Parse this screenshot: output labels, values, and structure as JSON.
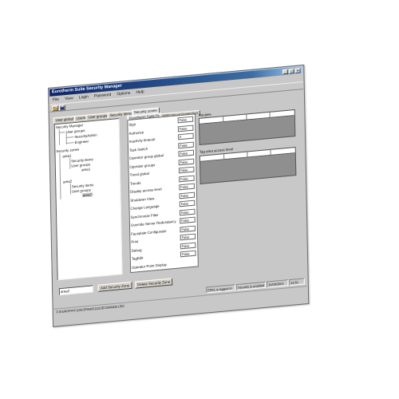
{
  "window": {
    "title": "Eurotherm Suite Security Manager"
  },
  "menu": [
    "File",
    "View",
    "Login",
    "Password",
    "Options",
    "Help"
  ],
  "toolbar": {
    "icons": [
      "open-folder-icon",
      "save-disk-icon"
    ]
  },
  "main_tabs": [
    "User global",
    "Users",
    "User groups",
    "Security items",
    "Security zones"
  ],
  "prop_tabs": [
    "Eurotherm Suite Pc",
    "1800 Visual Supervisor"
  ],
  "tree": {
    "root": "Security Manager",
    "user_groups": "User groups",
    "security_admin": "SecurityAdmin",
    "engineer": "Engineer",
    "zones": "Security zones",
    "area1": "area1",
    "security_items": "Security items",
    "user_groups_2": "User groups",
    "area1_item": "area1",
    "area2": "area2",
    "security_items_2": "Security items",
    "user_groups_3": "User groups",
    "area2_item": "area2"
  },
  "properties": [
    {
      "name": "Sign",
      "value": "False"
    },
    {
      "name": "Authorize",
      "value": "False"
    },
    {
      "name": "Inactivity timeout",
      "value": "0"
    },
    {
      "name": "Task Switch",
      "value": "False"
    },
    {
      "name": "Operator group global",
      "value": "False"
    },
    {
      "name": "Operator groups",
      "value": "False"
    },
    {
      "name": "Trend global",
      "value": "False"
    },
    {
      "name": "Trends",
      "value": "False"
    },
    {
      "name": "Display access level",
      "value": "False"
    },
    {
      "name": "Shutdown View",
      "value": "False"
    },
    {
      "name": "Change Language",
      "value": "False"
    },
    {
      "name": "Synchronize Files",
      "value": "False"
    },
    {
      "name": "Override Server Redundancy",
      "value": "False"
    },
    {
      "name": "Faceplate Configurator",
      "value": "False"
    },
    {
      "name": "Print",
      "value": "False"
    },
    {
      "name": "Debug",
      "value": "False"
    },
    {
      "name": "TagEdit",
      "value": "False"
    },
    {
      "name": "Operator Point Display",
      "value": ""
    }
  ],
  "right_panel": {
    "recipes_label": "Recipes",
    "tag_area_label": "Tag area access level"
  },
  "bottom": {
    "zone_name_value": "area2",
    "add_label": "Add Security Zone",
    "delete_label": "Delete Security Zone"
  },
  "status": {
    "seg1": "EPA1 is logged in",
    "seg2": "Security is enabled",
    "seg3": "15/09/2001",
    "seg4": "12:51"
  },
  "path": "F:\\EUROP\\PC\\23\\CFRNAR111\\SECMAND8.UDC",
  "colors": {
    "titlebar": "#0a246a",
    "window_face": "#c8c8c8",
    "grid_fill": "#8f8f8f"
  }
}
